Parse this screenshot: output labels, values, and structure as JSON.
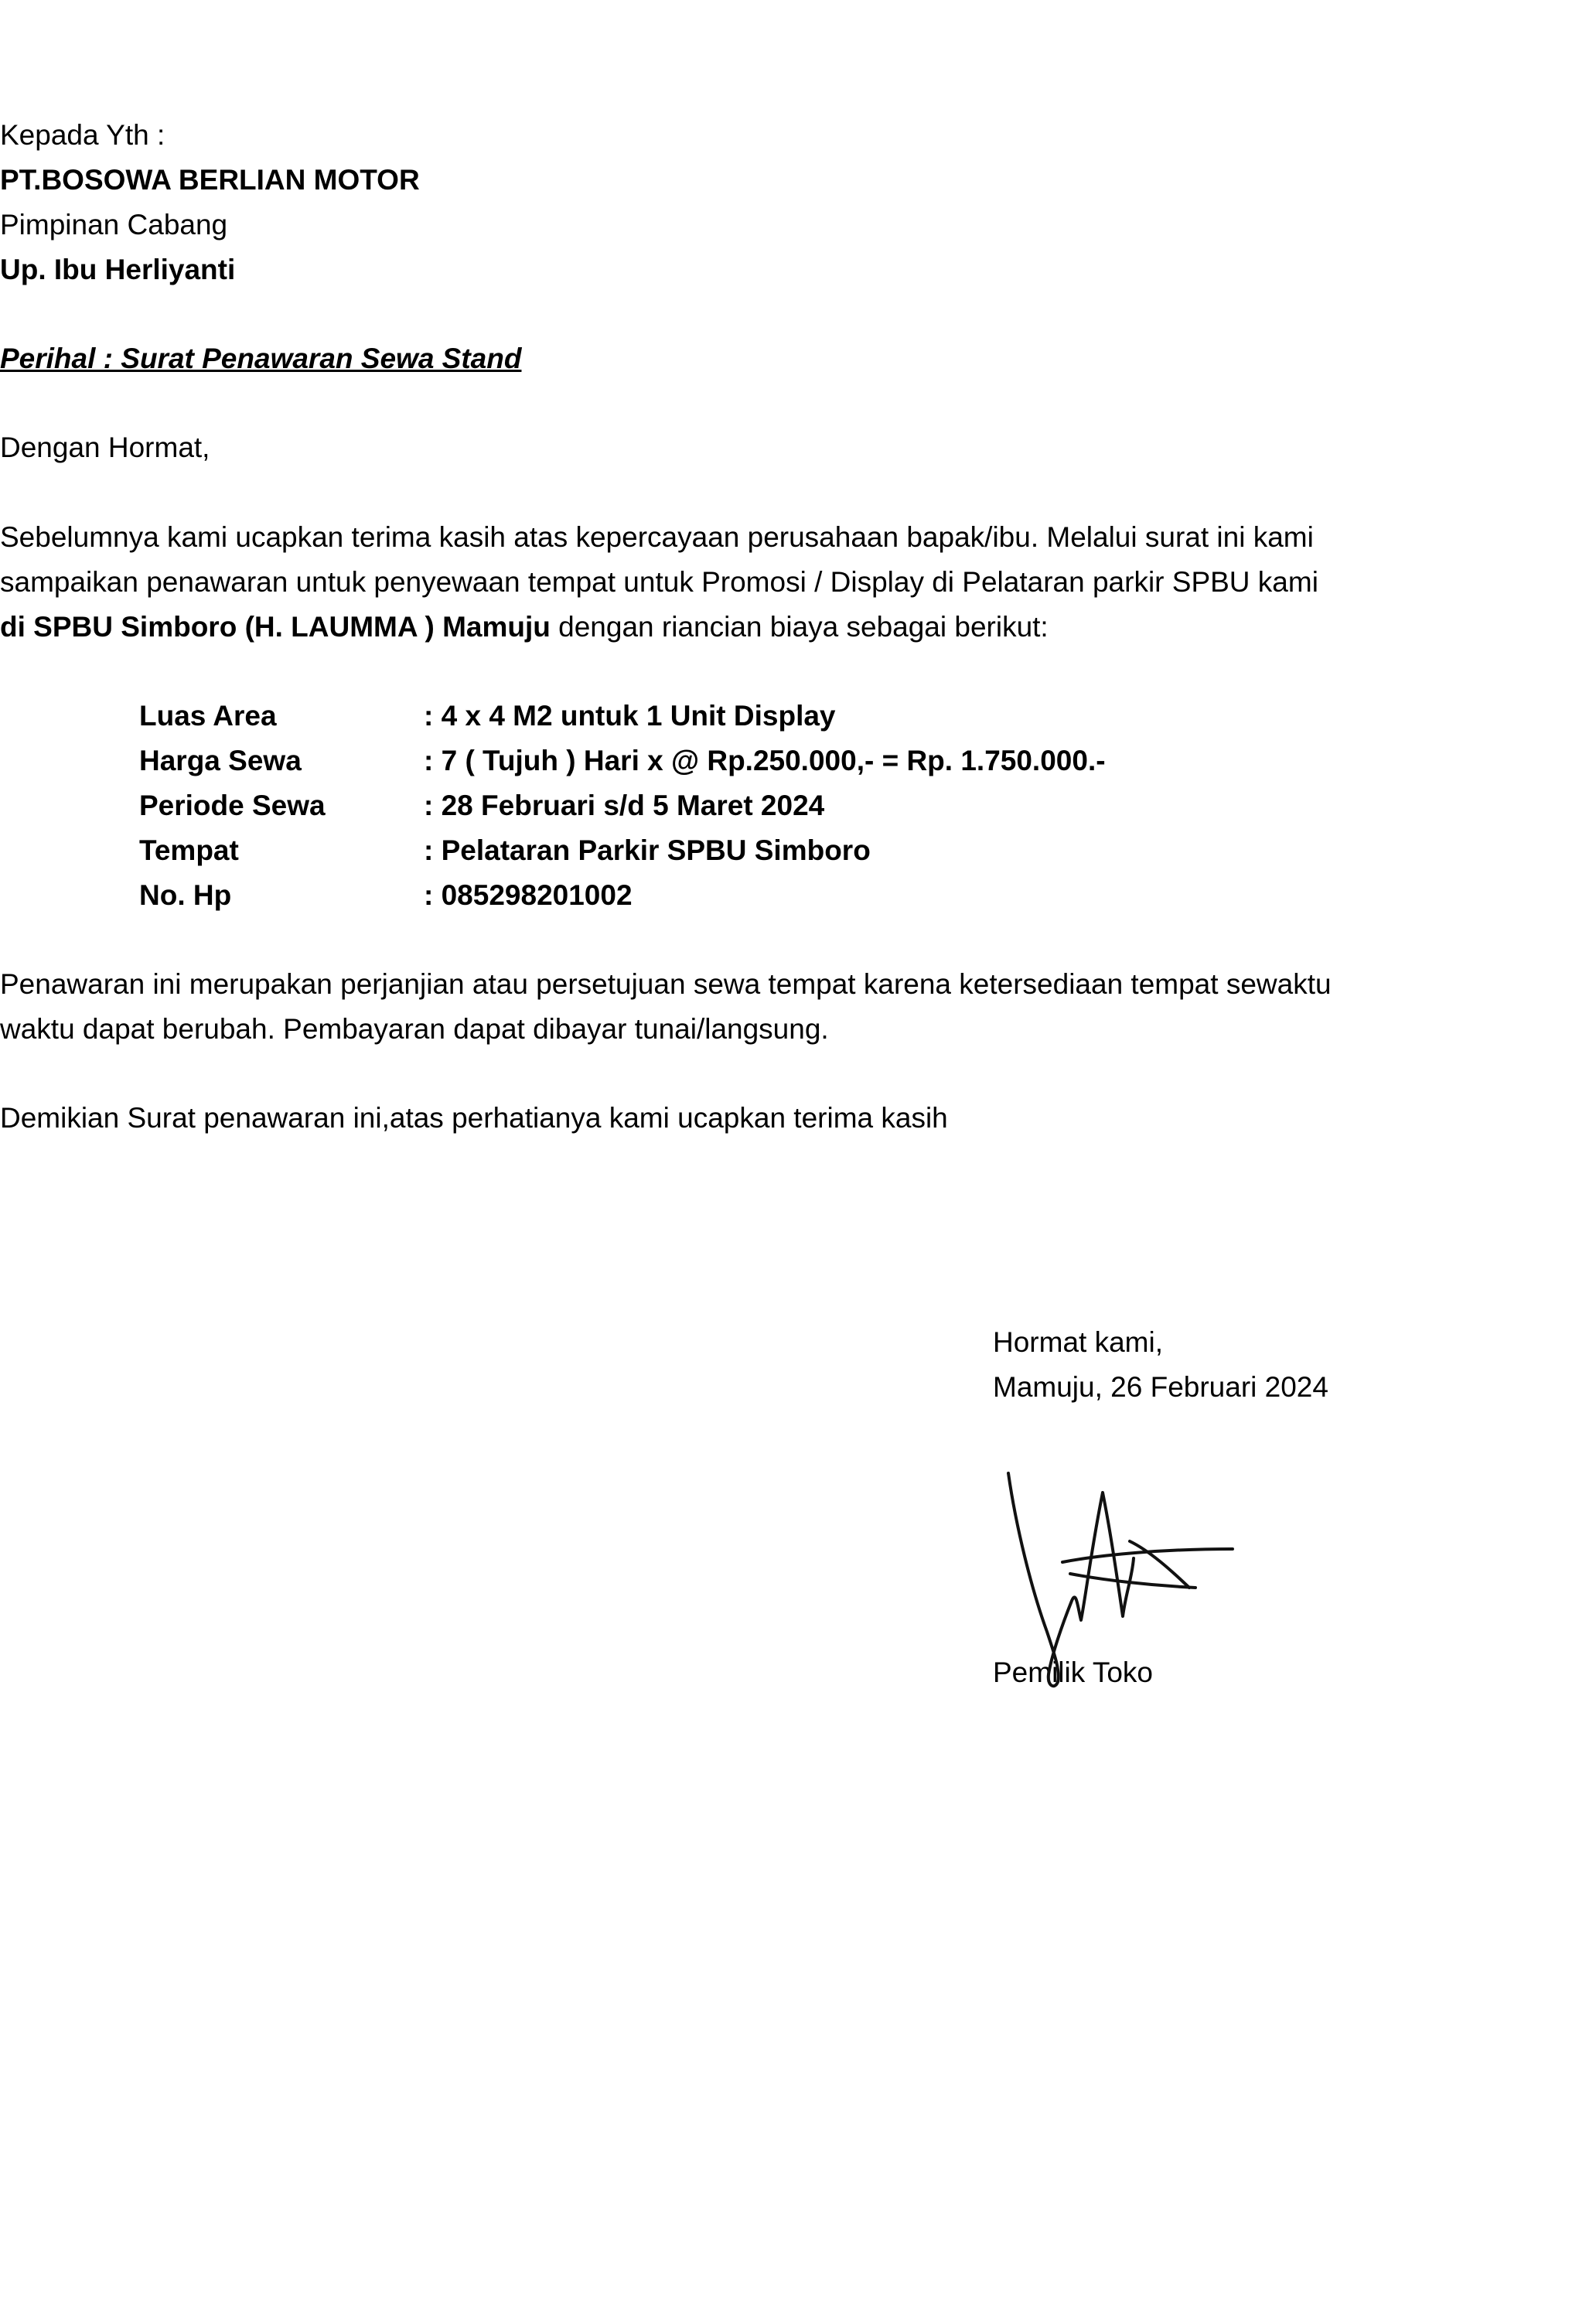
{
  "recipient": {
    "salutation_to": "Kepada Yth :",
    "company": "PT.BOSOWA BERLIAN MOTOR",
    "position": "Pimpinan Cabang",
    "attention": "Up. Ibu Herliyanti"
  },
  "subject": "Perihal : Surat Penawaran Sewa Stand",
  "greeting": "Dengan Hormat,",
  "intro": {
    "line1": "Sebelumnya kami ucapkan terima kasih atas kepercayaan perusahaan bapak/ibu. Melalui surat ini kami",
    "line2": "sampaikan penawaran untuk penyewaan tempat untuk Promosi / Display di Pelataran parkir SPBU kami",
    "line3_bold": "di SPBU Simboro (H. LAUMMA ) Mamuju",
    "line3_rest": " dengan riancian biaya sebagai berikut:"
  },
  "details": [
    {
      "label": "Luas Area",
      "value": ": 4 x 4 M2  untuk 1 Unit Display"
    },
    {
      "label": "Harga Sewa",
      "value": ": 7 ( Tujuh ) Hari x @ Rp.250.000,- = Rp. 1.750.000.-"
    },
    {
      "label": "Periode Sewa",
      "value": ": 28 Februari s/d 5 Maret 2024"
    },
    {
      "label": "Tempat",
      "value": ": Pelataran Parkir SPBU Simboro"
    },
    {
      "label": "No. Hp",
      "value": ": 085298201002"
    }
  ],
  "terms": {
    "line1": "Penawaran ini merupakan perjanjian atau persetujuan sewa tempat karena ketersediaan tempat sewaktu",
    "line2": "waktu dapat berubah. Pembayaran dapat dibayar tunai/langsung."
  },
  "closing_sentence": "Demikian Surat penawaran ini,atas perhatianya kami ucapkan terima kasih",
  "closing": {
    "regards": "Hormat kami,",
    "place_date": "Mamuju, 26 Februari 2024",
    "signatory": "Pemilik Toko"
  }
}
